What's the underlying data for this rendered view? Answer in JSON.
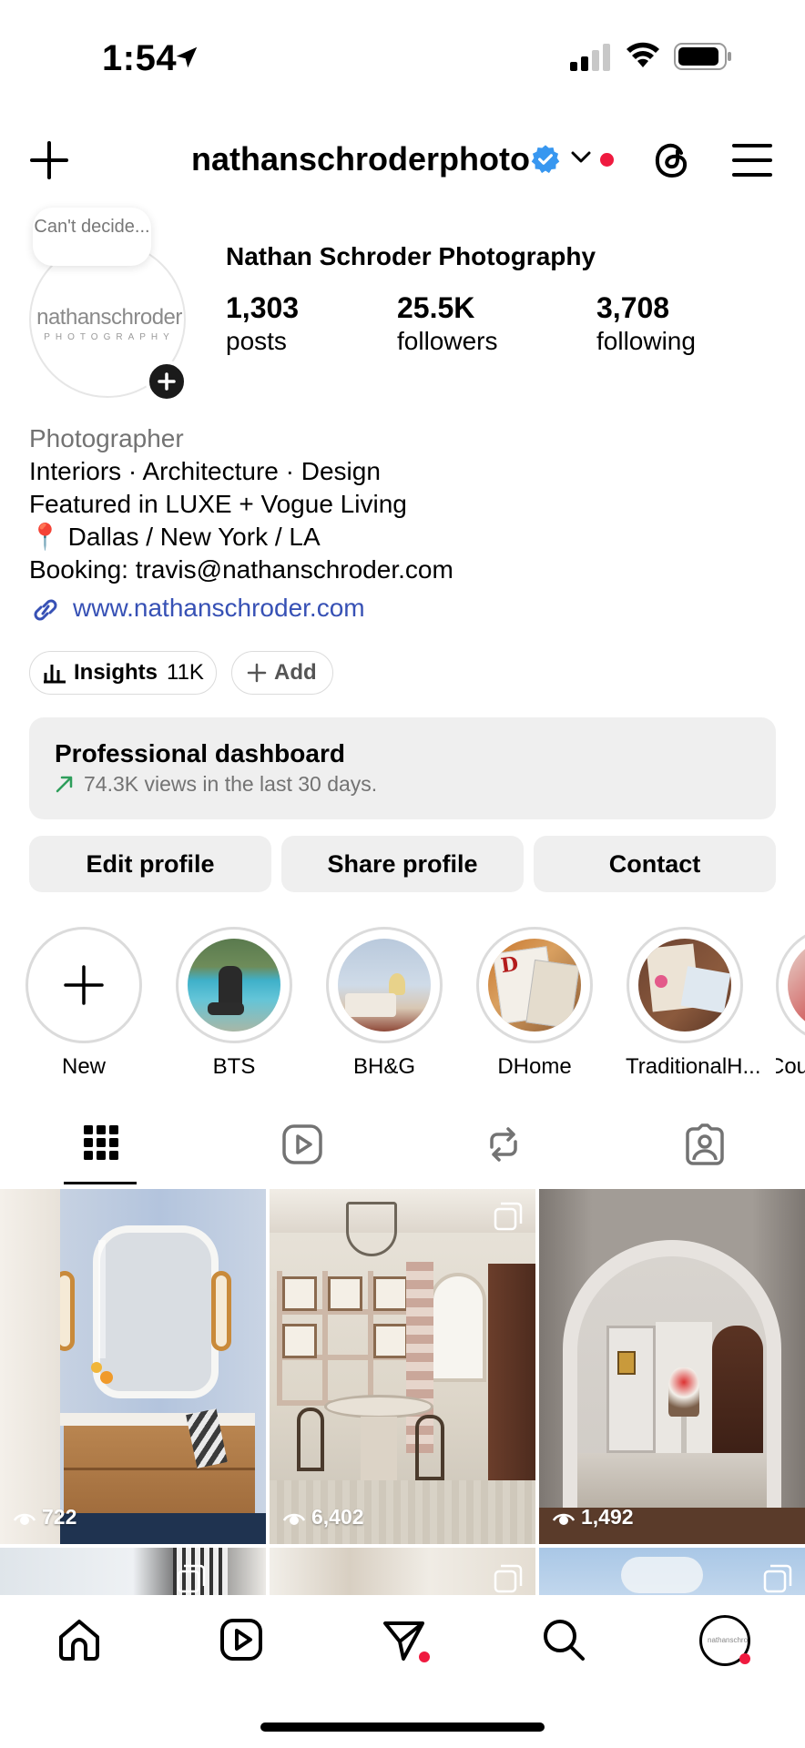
{
  "status": {
    "time": "1:54"
  },
  "header": {
    "username": "nathanschroderphoto"
  },
  "profile": {
    "bubble_note": "Can't decide...",
    "avatar_logo_main": "nathanschroder",
    "avatar_logo_sub": "PHOTOGRAPHY",
    "full_name": "Nathan Schroder Photography",
    "stats": [
      {
        "num": "1,303",
        "label": "posts"
      },
      {
        "num": "25.5K",
        "label": "followers"
      },
      {
        "num": "3,708",
        "label": "following"
      }
    ],
    "category": "Photographer",
    "bio_lines": [
      "Interiors · Architecture · Design",
      "Featured in LUXE + Vogue Living",
      "📍 Dallas / New York / LA",
      "Booking: travis@nathanschroder.com"
    ],
    "link": "www.nathanschroder.com"
  },
  "pills": {
    "insights_label": "Insights",
    "insights_count": "11K",
    "add_label": "Add"
  },
  "dashboard": {
    "title": "Professional dashboard",
    "subtitle": "74.3K views in the last 30 days."
  },
  "buttons": {
    "edit": "Edit profile",
    "share": "Share profile",
    "contact": "Contact"
  },
  "highlights": [
    {
      "label": "New"
    },
    {
      "label": "BTS"
    },
    {
      "label": "BH&G"
    },
    {
      "label": "DHome"
    },
    {
      "label": "TraditionalH..."
    },
    {
      "label": "Cou"
    }
  ],
  "tabs": [
    "grid-icon",
    "reels-icon",
    "reposts-icon",
    "tagged-icon"
  ],
  "posts": [
    {
      "views": "722"
    },
    {
      "views": "6,402"
    },
    {
      "views": "1,492"
    }
  ],
  "colors": {
    "accent_red": "#ef1a3f",
    "link_blue": "#3751b5",
    "verified_blue": "#3897f0",
    "button_bg": "#efefef"
  }
}
